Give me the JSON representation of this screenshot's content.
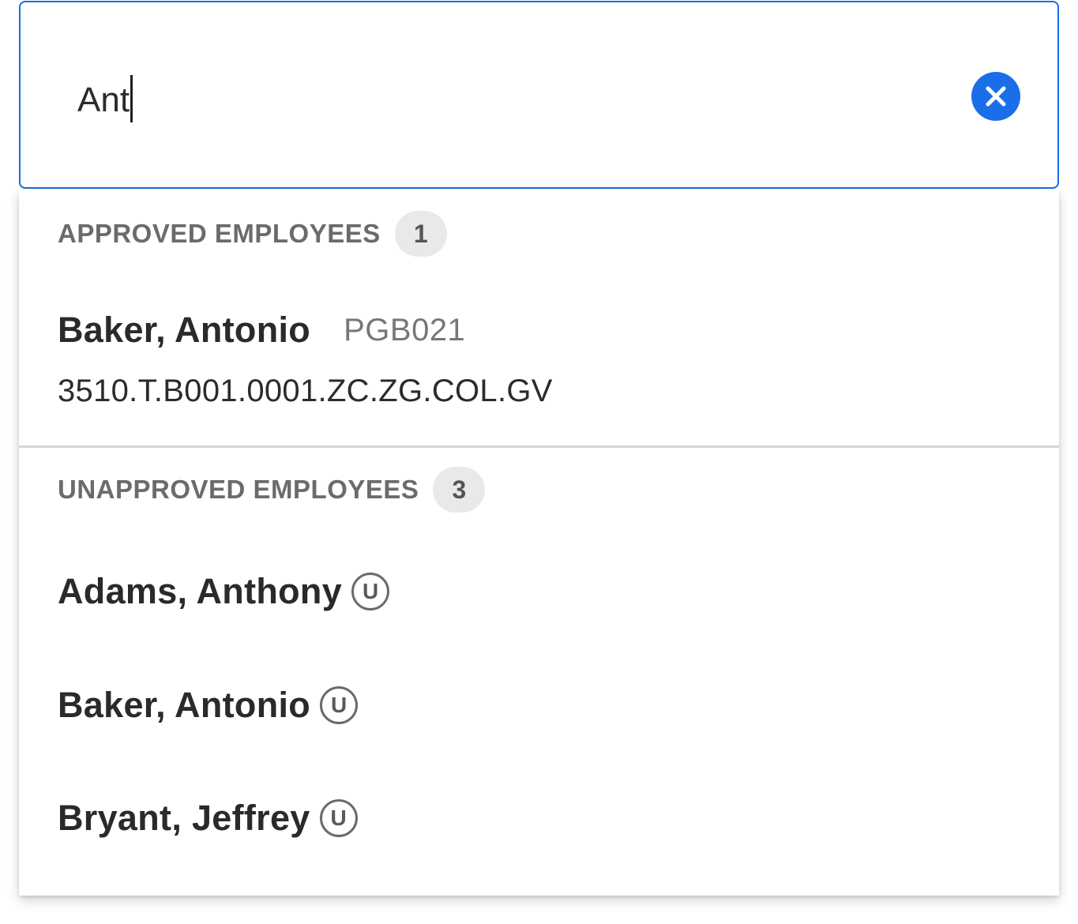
{
  "search": {
    "value": "Ant",
    "clear_icon": "close-circle-icon",
    "accent_color": "#1a6ee8"
  },
  "approved": {
    "header": "APPROVED EMPLOYEES",
    "count": "1",
    "items": [
      {
        "name": "Baker, Antonio",
        "code": "PGB021",
        "account": "3510.T.B001.0001.ZC.ZG.COL.GV"
      }
    ]
  },
  "unapproved": {
    "header": "UNAPPROVED EMPLOYEES",
    "count": "3",
    "badge_label": "U",
    "items": [
      {
        "name": "Adams, Anthony"
      },
      {
        "name": "Baker, Antonio"
      },
      {
        "name": "Bryant, Jeffrey"
      }
    ]
  }
}
